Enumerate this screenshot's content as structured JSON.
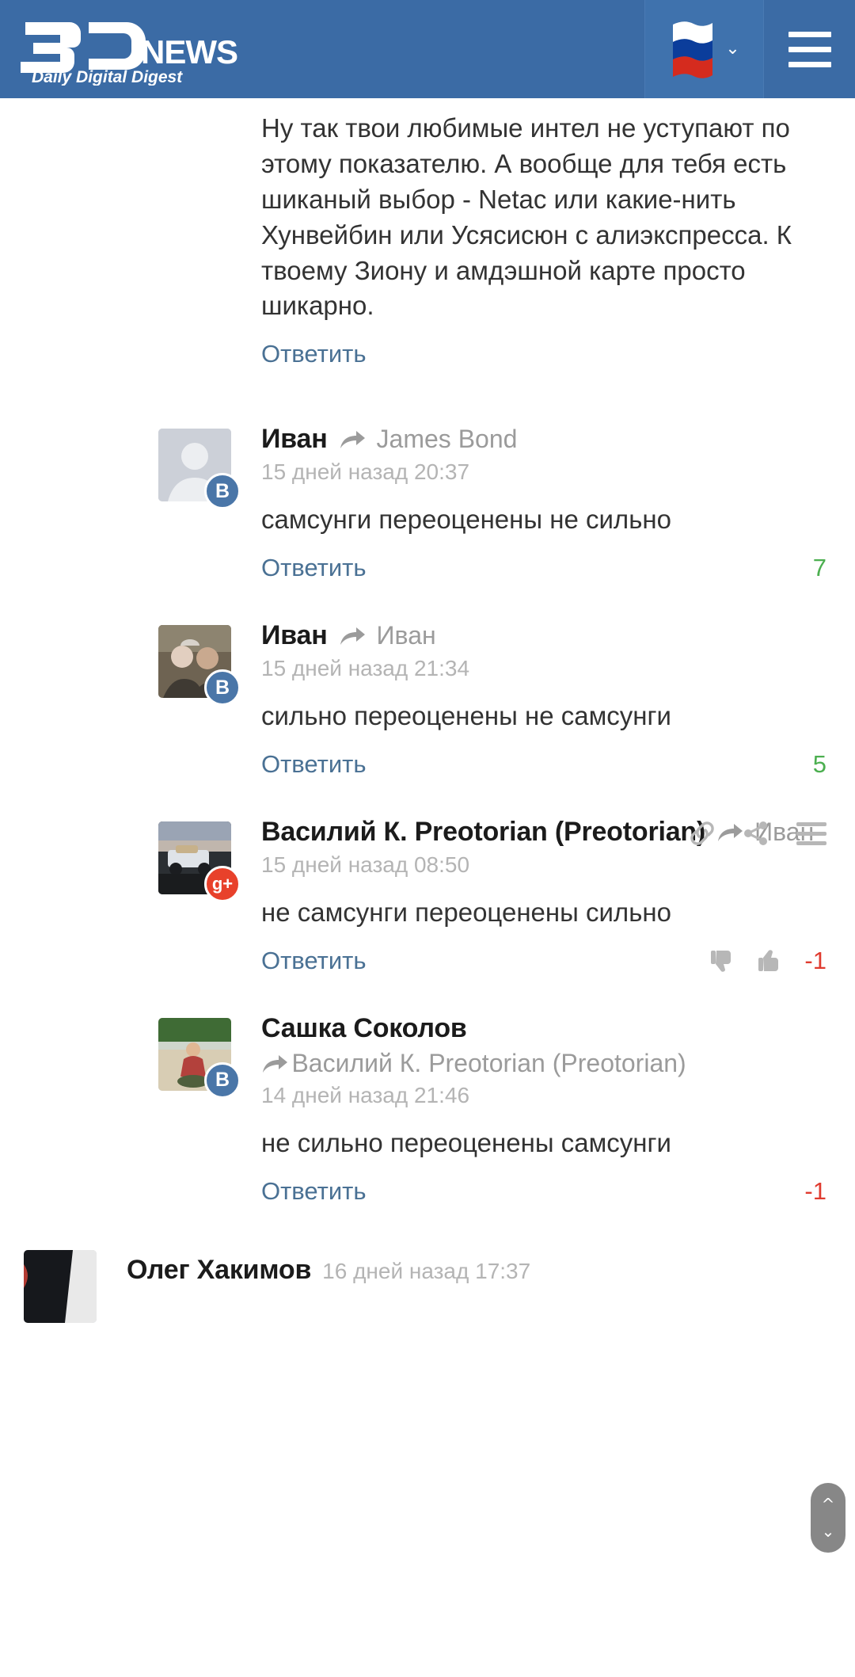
{
  "header": {
    "logo_main": "3D",
    "logo_news": "NEWS",
    "logo_tagline": "Daily Digital Digest",
    "language_flag": "russia-flag-icon",
    "language_chevron": "chevron-down-icon",
    "menu_icon": "hamburger-menu-icon",
    "background_color": "#3b6ba5"
  },
  "labels": {
    "reply": "Ответить",
    "reply_arrow_icon": "reply-arrow-icon",
    "link_icon": "link-icon",
    "share_icon": "share-icon",
    "more_icon": "more-menu-icon",
    "thumb_up_icon": "thumb-up-icon",
    "thumb_down_icon": "thumb-down-icon",
    "scroll_up_icon": "chevron-up-icon",
    "scroll_down_icon": "chevron-down-icon"
  },
  "colors": {
    "reply_link": "#4a7194",
    "score_positive": "#4caf50",
    "score_negative": "#e03b2f",
    "vk_badge": "#4a76a8",
    "gplus_badge": "#e8412b"
  },
  "comments": [
    {
      "id": "lead",
      "text": "Ну так твои любимые интел не уступают по этому показателю. А вообще для тебя есть шиканый выбор - Netac или какие-нить Хунвейбин или Усясисюн с алиэкспресса. К твоему Зиону и амдэшной карте просто шикарно.",
      "reply_label": "Ответить",
      "score": "",
      "score_sign": ""
    },
    {
      "id": "c1",
      "author": "Иван",
      "reply_to": "James Bond",
      "timestamp": "15 дней назад 20:37",
      "network": "vk",
      "network_letter": "B",
      "avatar_kind": "placeholder-person",
      "text": "самсунги переоценены не сильно",
      "reply_label": "Ответить",
      "score": "7",
      "score_sign": "pos"
    },
    {
      "id": "c2",
      "author": "Иван",
      "reply_to": "Иван",
      "timestamp": "15 дней назад 21:34",
      "network": "vk",
      "network_letter": "B",
      "avatar_kind": "photo-two-people",
      "text": "сильно переоценены не самсунги",
      "reply_label": "Ответить",
      "score": "5",
      "score_sign": "pos"
    },
    {
      "id": "c3",
      "author": "Василий К. Preotorian (Preotorian)",
      "reply_to": "Иван",
      "timestamp": "15 дней назад 08:50",
      "network": "gplus",
      "network_letter": "g+",
      "avatar_kind": "photo-truck",
      "text": "не самсунги переоценены сильно",
      "reply_label": "Ответить",
      "score": "-1",
      "score_sign": "neg",
      "has_action_icons": true,
      "has_vote_buttons": true
    },
    {
      "id": "c4",
      "author": "Сашка Соколов",
      "reply_to": "Василий К. Preotorian (Preotorian)",
      "timestamp": "14 дней назад 21:46",
      "network": "vk",
      "network_letter": "B",
      "avatar_kind": "photo-beach",
      "text": "не сильно переоценены самсунги",
      "reply_label": "Ответить",
      "score": "-1",
      "score_sign": "neg"
    },
    {
      "id": "c5",
      "author": "Олег Хакимов",
      "reply_to": "",
      "timestamp": "16 дней назад 17:37",
      "network": "",
      "network_letter": "",
      "avatar_kind": "photo-dark",
      "text": "",
      "reply_label": "",
      "score": "",
      "score_sign": ""
    }
  ]
}
